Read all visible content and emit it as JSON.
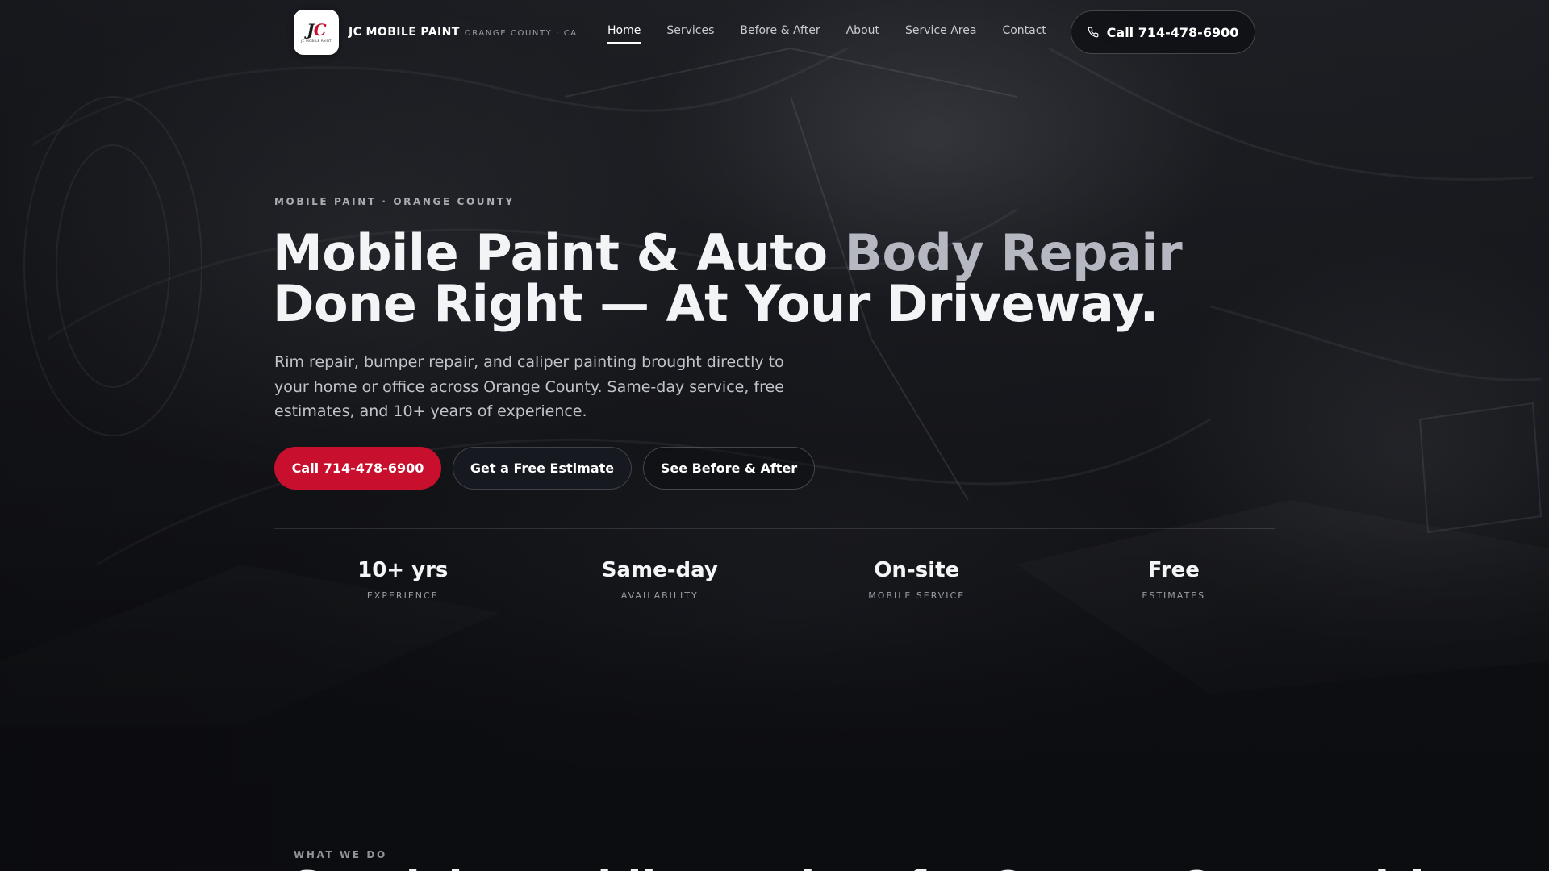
{
  "brand": {
    "name": "JC MOBILE PAINT",
    "location": "ORANGE COUNTY · CA",
    "logo_mark_j": "J",
    "logo_mark_c": "C",
    "logo_subtext": "JC MOBILE PAINT"
  },
  "nav": {
    "items": [
      {
        "label": "Home",
        "active": true
      },
      {
        "label": "Services"
      },
      {
        "label": "Before & After"
      },
      {
        "label": "About"
      },
      {
        "label": "Service Area"
      },
      {
        "label": "Contact"
      }
    ]
  },
  "header_cta": {
    "label": "Call 714-478-6900",
    "icon": "phone-icon"
  },
  "hero": {
    "eyebrow": "MOBILE PAINT · ORANGE COUNTY",
    "headline_part1": "Mobile Paint & Auto ",
    "headline_part2": "Body Repair",
    "headline_part3": "Done Right — At Your Driveway.",
    "subcopy": "Rim repair, bumper repair, and caliper painting brought directly to your home or office across Orange County. Same-day service, free estimates, and 10+ years of experience.",
    "buttons": {
      "call": "Call 714-478-6900",
      "estimate": "Get a Free Estimate",
      "before_after": "See Before & After"
    },
    "stats": [
      {
        "value": "10+ yrs",
        "label": "EXPERIENCE"
      },
      {
        "value": "Same-day",
        "label": "AVAILABILITY"
      },
      {
        "value": "On-site",
        "label": "MOBILE SERVICE"
      },
      {
        "value": "Free",
        "label": "ESTIMATES"
      }
    ]
  },
  "services_section": {
    "eyebrow": "WHAT WE DO",
    "title": "Specialty mobile services for Orange County drivers"
  },
  "colors": {
    "accent_red": "#c8102e",
    "background": "#0d0e12",
    "text_primary": "#f3f4f6"
  }
}
